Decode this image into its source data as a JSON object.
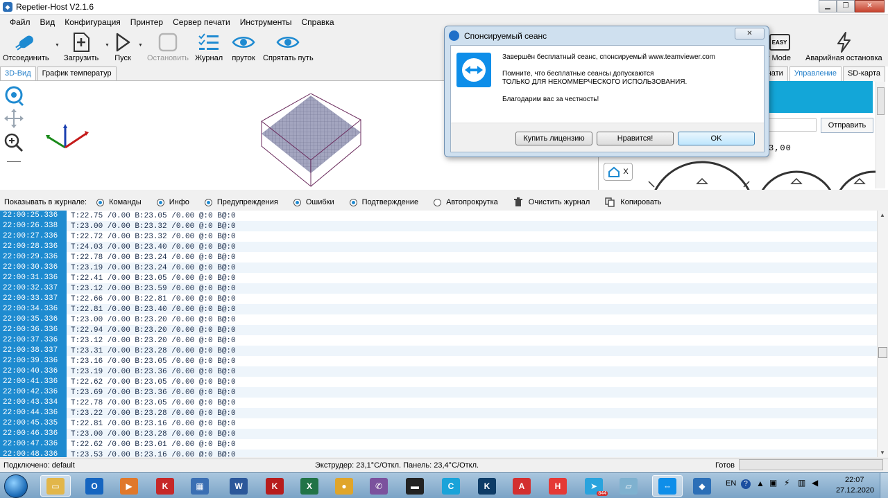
{
  "window": {
    "title": "Repetier-Host V2.1.6",
    "minimize": "▁",
    "maximize": "❐",
    "close": "✕"
  },
  "menu": [
    "Файл",
    "Вид",
    "Конфигурация",
    "Принтер",
    "Сервер печати",
    "Инструменты",
    "Справка"
  ],
  "toolbar": {
    "disconnect": "Отсоединить",
    "load": "Загрузить",
    "run": "Пуск",
    "stop": "Остановить",
    "log": "Журнал",
    "filament": "пруток",
    "hide_path": "Спрятать путь",
    "easy_mode": "Easy Mode",
    "easy_badge": "EASY",
    "emergency": "Аварийная остановка"
  },
  "left_tabs": [
    "3D-Вид",
    "График температур"
  ],
  "right_tabs": [
    "чати",
    "Управление",
    "SD-карта"
  ],
  "right_panel": {
    "send": "Отправить",
    "temp_fragment": "3,00",
    "home_label": "X"
  },
  "filter": {
    "label": "Показывать в журнале:",
    "options": [
      {
        "label": "Команды",
        "on": true
      },
      {
        "label": "Инфо",
        "on": true
      },
      {
        "label": "Предупреждения",
        "on": true
      },
      {
        "label": "Ошибки",
        "on": true
      },
      {
        "label": "Подтверждение",
        "on": true
      },
      {
        "label": "Автопрокрутка",
        "on": false
      }
    ],
    "clear": "Очистить журнал",
    "copy": "Копировать"
  },
  "log": [
    {
      "time": "22:00:25.336",
      "text": "T:22.75 /0.00 B:23.05 /0.00 @:0 B@:0"
    },
    {
      "time": "22:00:26.338",
      "text": "T:23.00 /0.00 B:23.32 /0.00 @:0 B@:0"
    },
    {
      "time": "22:00:27.336",
      "text": "T:22.72 /0.00 B:23.32 /0.00 @:0 B@:0"
    },
    {
      "time": "22:00:28.336",
      "text": "T:24.03 /0.00 B:23.40 /0.00 @:0 B@:0"
    },
    {
      "time": "22:00:29.336",
      "text": "T:22.78 /0.00 B:23.24 /0.00 @:0 B@:0"
    },
    {
      "time": "22:00:30.336",
      "text": "T:23.19 /0.00 B:23.24 /0.00 @:0 B@:0"
    },
    {
      "time": "22:00:31.336",
      "text": "T:22.41 /0.00 B:23.05 /0.00 @:0 B@:0"
    },
    {
      "time": "22:00:32.337",
      "text": "T:23.12 /0.00 B:23.59 /0.00 @:0 B@:0"
    },
    {
      "time": "22:00:33.337",
      "text": "T:22.66 /0.00 B:22.81 /0.00 @:0 B@:0"
    },
    {
      "time": "22:00:34.336",
      "text": "T:22.81 /0.00 B:23.40 /0.00 @:0 B@:0"
    },
    {
      "time": "22:00:35.336",
      "text": "T:23.00 /0.00 B:23.20 /0.00 @:0 B@:0"
    },
    {
      "time": "22:00:36.336",
      "text": "T:22.94 /0.00 B:23.20 /0.00 @:0 B@:0"
    },
    {
      "time": "22:00:37.336",
      "text": "T:23.12 /0.00 B:23.20 /0.00 @:0 B@:0"
    },
    {
      "time": "22:00:38.337",
      "text": "T:23.31 /0.00 B:23.28 /0.00 @:0 B@:0"
    },
    {
      "time": "22:00:39.336",
      "text": "T:23.16 /0.00 B:23.05 /0.00 @:0 B@:0"
    },
    {
      "time": "22:00:40.336",
      "text": "T:23.19 /0.00 B:23.36 /0.00 @:0 B@:0"
    },
    {
      "time": "22:00:41.336",
      "text": "T:22.62 /0.00 B:23.05 /0.00 @:0 B@:0"
    },
    {
      "time": "22:00:42.336",
      "text": "T:23.69 /0.00 B:23.36 /0.00 @:0 B@:0"
    },
    {
      "time": "22:00:43.334",
      "text": "T:22.78 /0.00 B:23.05 /0.00 @:0 B@:0"
    },
    {
      "time": "22:00:44.336",
      "text": "T:23.22 /0.00 B:23.28 /0.00 @:0 B@:0"
    },
    {
      "time": "22:00:45.335",
      "text": "T:22.81 /0.00 B:23.16 /0.00 @:0 B@:0"
    },
    {
      "time": "22:00:46.336",
      "text": "T:23.00 /0.00 B:23.28 /0.00 @:0 B@:0"
    },
    {
      "time": "22:00:47.336",
      "text": "T:22.62 /0.00 B:23.01 /0.00 @:0 B@:0"
    },
    {
      "time": "22:00:48.336",
      "text": "T:23.53 /0.00 B:23.16 /0.00 @:0 B@:0"
    }
  ],
  "status": {
    "connected": "Подключено: default",
    "temps": "Экструдер: 23,1°C/Откл. Панель: 23,4°C/Откл.",
    "ready": "Готов"
  },
  "dialog": {
    "title": "Спонсируемый сеанс",
    "close": "✕",
    "line1": "Завершён бесплатный сеанс, спонсируемый www.teamviewer.com",
    "line2": "Помните, что бесплатные сеансы допускаются",
    "line3": "ТОЛЬКО ДЛЯ НЕКОММЕРЧЕСКОГО ИСПОЛЬЗОВАНИЯ.",
    "line4": "Благодарим вас за честность!",
    "buy": "Купить лицензию",
    "like": "Нравится!",
    "ok": "OK"
  },
  "taskbar": {
    "lang": "EN",
    "time": "22:07",
    "date": "27.12.2020",
    "apps": [
      {
        "name": "explorer",
        "color": "#e2b64a",
        "glyph": "▭"
      },
      {
        "name": "outlook",
        "color": "#1565c0",
        "glyph": "O"
      },
      {
        "name": "media",
        "color": "#e0782b",
        "glyph": "▶"
      },
      {
        "name": "kompas-red",
        "color": "#c62828",
        "glyph": "K"
      },
      {
        "name": "network",
        "color": "#3b6fb3",
        "glyph": "▦"
      },
      {
        "name": "word",
        "color": "#2b579a",
        "glyph": "W"
      },
      {
        "name": "kompas",
        "color": "#b71c1c",
        "glyph": "K"
      },
      {
        "name": "excel",
        "color": "#217346",
        "glyph": "X"
      },
      {
        "name": "chrome",
        "color": "#e0a52a",
        "glyph": "●"
      },
      {
        "name": "viber",
        "color": "#7b519d",
        "glyph": "✆"
      },
      {
        "name": "terminal",
        "color": "#222222",
        "glyph": "▬"
      },
      {
        "name": "c-app",
        "color": "#1aa3d9",
        "glyph": "C"
      },
      {
        "name": "k-app",
        "color": "#0d3b66",
        "glyph": "K"
      },
      {
        "name": "acrobat",
        "color": "#d32f2f",
        "glyph": "A"
      },
      {
        "name": "h-app",
        "color": "#e53935",
        "glyph": "H"
      },
      {
        "name": "telegram",
        "color": "#2aa3dd",
        "glyph": "➤"
      },
      {
        "name": "notes",
        "color": "#7fb1cf",
        "glyph": "▱"
      },
      {
        "name": "teamviewer",
        "color": "#0e8ee9",
        "glyph": "⇔"
      },
      {
        "name": "repetier",
        "color": "#2c6fb7",
        "glyph": "◆"
      }
    ],
    "telegram_badge": "844"
  }
}
